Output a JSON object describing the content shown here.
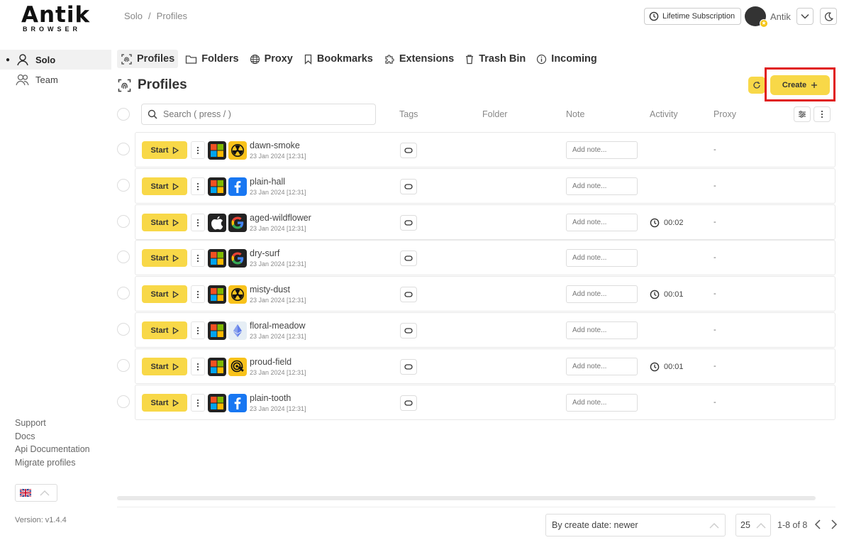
{
  "app": {
    "logo_main": "Antik",
    "logo_sub": "BROWSER",
    "version": "Version: v1.4.4"
  },
  "breadcrumb": {
    "root": "Solo",
    "separator": "/",
    "current": "Profiles"
  },
  "header": {
    "subscription": "Lifetime Subscription",
    "user_name": "Antik"
  },
  "sidebar": {
    "items": [
      {
        "label": "Solo",
        "active": true
      },
      {
        "label": "Team",
        "active": false
      }
    ],
    "links": [
      "Support",
      "Docs",
      "Api Documentation",
      "Migrate profiles"
    ]
  },
  "tabs": [
    {
      "label": "Profiles",
      "icon": "fingerprint-icon",
      "active": true
    },
    {
      "label": "Folders",
      "icon": "folder-icon",
      "active": false
    },
    {
      "label": "Proxy",
      "icon": "globe-icon",
      "active": false
    },
    {
      "label": "Bookmarks",
      "icon": "bookmark-icon",
      "active": false
    },
    {
      "label": "Extensions",
      "icon": "puzzle-icon",
      "active": false
    },
    {
      "label": "Trash Bin",
      "icon": "trash-icon",
      "active": false
    },
    {
      "label": "Incoming",
      "icon": "info-icon",
      "active": false
    }
  ],
  "page": {
    "title": "Profiles",
    "create_label": "Create"
  },
  "table": {
    "search_placeholder": "Search ( press / )",
    "columns": {
      "tags": "Tags",
      "folder": "Folder",
      "note": "Note",
      "activity": "Activity",
      "proxy": "Proxy"
    },
    "start_label": "Start",
    "note_placeholder": "Add note...",
    "rows": [
      {
        "name": "dawn-smoke",
        "date": "23 Jan 2024 [12:31]",
        "os": "windows",
        "browser": "nuclear",
        "activity": "",
        "proxy": "-"
      },
      {
        "name": "plain-hall",
        "date": "23 Jan 2024 [12:31]",
        "os": "windows",
        "browser": "facebook",
        "activity": "",
        "proxy": "-"
      },
      {
        "name": "aged-wildflower",
        "date": "23 Jan 2024 [12:31]",
        "os": "apple",
        "browser": "google",
        "activity": "00:02",
        "proxy": "-"
      },
      {
        "name": "dry-surf",
        "date": "23 Jan 2024 [12:31]",
        "os": "windows",
        "browser": "google",
        "activity": "",
        "proxy": "-"
      },
      {
        "name": "misty-dust",
        "date": "23 Jan 2024 [12:31]",
        "os": "windows",
        "browser": "nuclear",
        "activity": "00:01",
        "proxy": "-"
      },
      {
        "name": "floral-meadow",
        "date": "23 Jan 2024 [12:31]",
        "os": "windows",
        "browser": "ethereum",
        "activity": "",
        "proxy": "-"
      },
      {
        "name": "proud-field",
        "date": "23 Jan 2024 [12:31]",
        "os": "windows",
        "browser": "target",
        "activity": "00:01",
        "proxy": "-"
      },
      {
        "name": "plain-tooth",
        "date": "23 Jan 2024 [12:31]",
        "os": "windows",
        "browser": "facebook",
        "activity": "",
        "proxy": "-"
      }
    ]
  },
  "footer": {
    "sort": "By create date: newer",
    "per_page": "25",
    "range": "1-8 of 8"
  },
  "colors": {
    "accent": "#f8d848",
    "highlight": "#e01b1b"
  }
}
